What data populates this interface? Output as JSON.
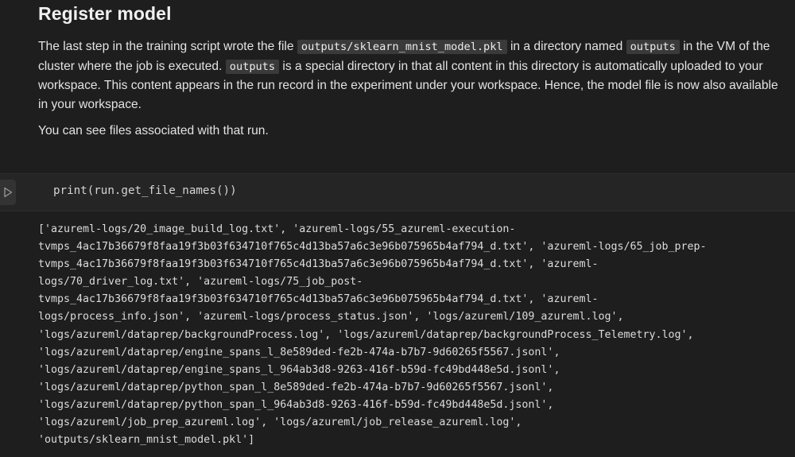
{
  "markdown": {
    "heading": "Register model",
    "para1_part1": "The last step in the training script wrote the file ",
    "code_model_file": "outputs/sklearn_mnist_model.pkl",
    "para1_part2": " in a directory named ",
    "code_outputs_1": "outputs",
    "para1_part3": " in the VM of the cluster where the job is executed. ",
    "code_outputs_2": "outputs",
    "para1_part4": " is a special directory in that all content in this directory is automatically uploaded to your workspace. This content appears in the run record in the experiment under your workspace. Hence, the model file is now also available in your workspace.",
    "para2": "You can see files associated with that run."
  },
  "code_cell": {
    "run_icon": "play-icon",
    "source": "print(run.get_file_names())"
  },
  "output": {
    "lines": [
      "['azureml-logs/20_image_build_log.txt', 'azureml-logs/55_azureml-execution-",
      "tvmps_4ac17b36679f8faa19f3b03f634710f765c4d13ba57a6c3e96b075965b4af794_d.txt', 'azureml-logs/65_job_prep-",
      "tvmps_4ac17b36679f8faa19f3b03f634710f765c4d13ba57a6c3e96b075965b4af794_d.txt', 'azureml-",
      "logs/70_driver_log.txt', 'azureml-logs/75_job_post-",
      "tvmps_4ac17b36679f8faa19f3b03f634710f765c4d13ba57a6c3e96b075965b4af794_d.txt', 'azureml-",
      "logs/process_info.json', 'azureml-logs/process_status.json', 'logs/azureml/109_azureml.log',",
      "'logs/azureml/dataprep/backgroundProcess.log', 'logs/azureml/dataprep/backgroundProcess_Telemetry.log',",
      "'logs/azureml/dataprep/engine_spans_l_8e589ded-fe2b-474a-b7b7-9d60265f5567.jsonl',",
      "'logs/azureml/dataprep/engine_spans_l_964ab3d8-9263-416f-b59d-fc49bd448e5d.jsonl',",
      "'logs/azureml/dataprep/python_span_l_8e589ded-fe2b-474a-b7b7-9d60265f5567.jsonl',",
      "'logs/azureml/dataprep/python_span_l_964ab3d8-9263-416f-b59d-fc49bd448e5d.jsonl',",
      "'logs/azureml/job_prep_azureml.log', 'logs/azureml/job_release_azureml.log',",
      "'outputs/sklearn_mnist_model.pkl']"
    ]
  },
  "colors": {
    "background": "#1e1e1e",
    "code_cell_background": "#252526",
    "inline_code_background": "#3a3a3a",
    "text": "#e3e3e3"
  }
}
